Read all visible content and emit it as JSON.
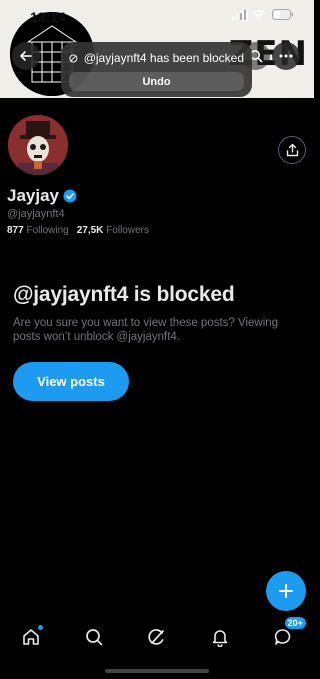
{
  "status_bar": {
    "time": "13:14"
  },
  "banner": {
    "text": "ZEN"
  },
  "toast": {
    "message": "@jayjaynft4 has been blocked",
    "undo_label": "Undo"
  },
  "profile": {
    "display_name": "Jayjay",
    "handle": "@jayjaynft4",
    "following_count": "877",
    "following_label": "Following",
    "followers_count": "27,5K",
    "followers_label": "Followers"
  },
  "blocked": {
    "title": "@jayjaynft4 is blocked",
    "description": "Are you sure you want to view these posts? Viewing posts won’t unblock @jayjaynft4.",
    "view_posts_label": "View posts"
  },
  "bottom_nav": {
    "items": [
      {
        "icon": "home-icon",
        "dot": true
      },
      {
        "icon": "search-icon"
      },
      {
        "icon": "grok-icon"
      },
      {
        "icon": "bell-icon"
      },
      {
        "icon": "messages-icon",
        "badge": "20+"
      }
    ]
  },
  "colors": {
    "accent": "#1d9bf0",
    "background": "#000000",
    "muted": "#71767b"
  }
}
